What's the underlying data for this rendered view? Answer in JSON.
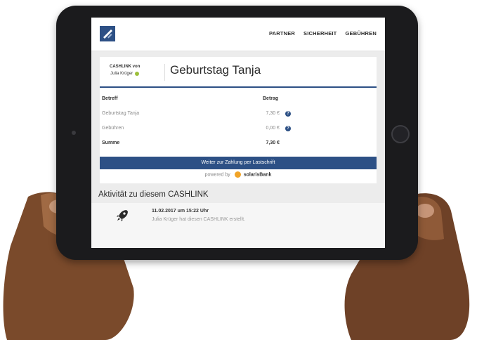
{
  "nav": {
    "links": [
      "PARTNER",
      "SICHERHEIT",
      "GEBÜHREN"
    ]
  },
  "sender": {
    "line1": "CASHLINK von",
    "name": "Julia Krüger"
  },
  "title": "Geburtstag Tanja",
  "table": {
    "header": {
      "label": "Betreff",
      "amount": "Betrag"
    },
    "rows": [
      {
        "label": "Geburtstag Tanja",
        "amount": "7,30 €"
      },
      {
        "label": "Gebühren",
        "amount": "0,00 €"
      }
    ],
    "sum": {
      "label": "Summe",
      "amount": "7,30 €"
    }
  },
  "cta_label": "Weiter zur Zahlung per Lastschrift",
  "powered": {
    "prefix": "powered by",
    "brand": "solarisBank"
  },
  "activity": {
    "title": "Aktivität zu diesem CASHLINK",
    "item": {
      "date": "11.02.2017 um 15:22 Uhr",
      "text": "Julia Krüger hat diesen CASHLINK erstellt."
    }
  },
  "colors": {
    "brand_blue": "#2d5085",
    "status_green": "#9cbf3a",
    "solaris_orange": "#f1a428"
  },
  "icons": [
    "cashlink-logo-icon",
    "info-icon",
    "rocket-icon",
    "solarisbank-logo-icon"
  ]
}
